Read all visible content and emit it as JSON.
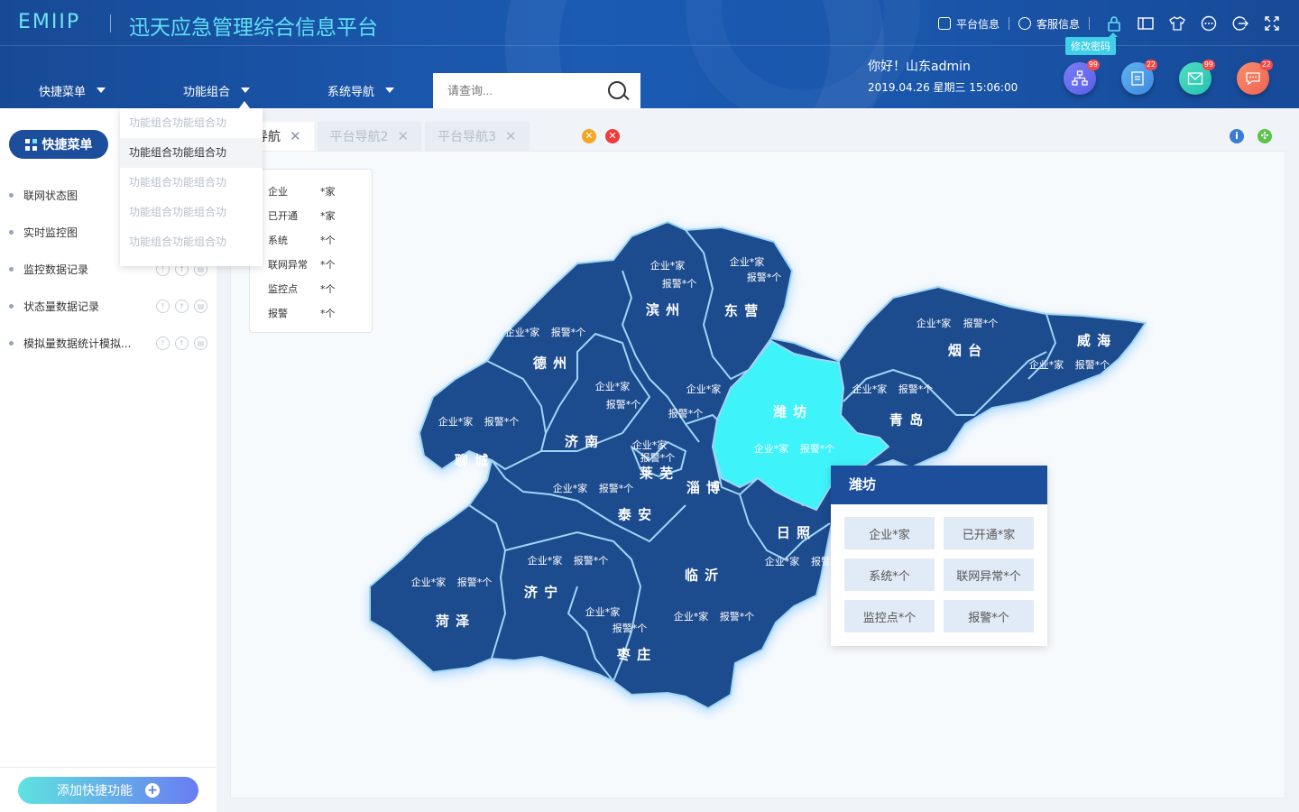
{
  "header": {
    "logo": "EMIIP",
    "title": "迅天应急管理综合信息平台",
    "links": [
      {
        "label": "平台信息",
        "icon": "monitor-icon"
      },
      {
        "label": "客服信息",
        "icon": "headset-icon"
      }
    ],
    "toolbar_icons": [
      "lock-icon",
      "book-icon",
      "shirt-icon",
      "more-icon",
      "logout-icon",
      "fullscreen-icon"
    ],
    "tooltip": "修改密码",
    "nav": [
      {
        "label": "快捷菜单"
      },
      {
        "label": "功能组合"
      },
      {
        "label": "系统导航"
      }
    ],
    "search_placeholder": "请查询...",
    "greeting": "你好！山东admin",
    "datetime": "2019.04.26  星期三  15:06:00",
    "circle_buttons": [
      {
        "icon": "org-chart-icon",
        "badge": "99",
        "color": "#6a6cf0"
      },
      {
        "icon": "document-icon",
        "badge": "22",
        "color": "#4f9de8"
      },
      {
        "icon": "mail-icon",
        "badge": "99",
        "color": "#33d1b8"
      },
      {
        "icon": "chat-icon",
        "badge": "22",
        "color": "#f3795e"
      }
    ]
  },
  "dropdown": {
    "items": [
      {
        "label": "功能组合功能组合功",
        "active": false
      },
      {
        "label": "功能组合功能组合功",
        "active": true
      },
      {
        "label": "功能组合功能组合功",
        "active": false
      },
      {
        "label": "功能组合功能组合功",
        "active": false
      },
      {
        "label": "功能组合功能组合功",
        "active": false
      }
    ]
  },
  "sidebar": {
    "button": "快捷菜单",
    "items": [
      {
        "label": "联网状态图"
      },
      {
        "label": "实时监控图"
      },
      {
        "label": "监控数据记录"
      },
      {
        "label": "状态量数据记录"
      },
      {
        "label": "模拟量数据统计模拟..."
      }
    ],
    "add_label": "添加快捷功能"
  },
  "tabs": [
    {
      "label": "台导航",
      "active": true
    },
    {
      "label": "平台导航2",
      "active": false
    },
    {
      "label": "平台导航3",
      "active": false
    }
  ],
  "stats": [
    {
      "k": "企业",
      "v": "*家"
    },
    {
      "k": "已开通",
      "v": "*家"
    },
    {
      "k": "系统",
      "v": "*个"
    },
    {
      "k": "联网异常",
      "v": "*个"
    },
    {
      "k": "监控点",
      "v": "*个"
    },
    {
      "k": "报警",
      "v": "*个"
    }
  ],
  "map": {
    "regions": [
      {
        "name": "滨 州",
        "a": "企业*家",
        "b": "报警*个",
        "highlight": false
      },
      {
        "name": "东 营",
        "a": "企业*家",
        "b": "报警*个",
        "highlight": false
      },
      {
        "name": "德 州",
        "a": "企业*家",
        "b": "报警*个",
        "highlight": false
      },
      {
        "name": "烟 台",
        "a": "企业*家",
        "b": "报警*个",
        "highlight": false
      },
      {
        "name": "威 海",
        "a": "企业*家",
        "b": "报警*个",
        "highlight": false
      },
      {
        "name": "潍 坊",
        "a": "企业*家",
        "b": "报警*个",
        "highlight": true
      },
      {
        "name": "青 岛",
        "a": "企业*家",
        "b": "报警*个",
        "highlight": false
      },
      {
        "name": "聊 城",
        "a": "企业*家",
        "b": "报警*个",
        "highlight": false
      },
      {
        "name": "济 南",
        "a": "企业*家",
        "b": "报警*个",
        "highlight": false
      },
      {
        "name": "莱 芜",
        "a": "企业*家",
        "b": "报警*个",
        "highlight": false
      },
      {
        "name": "淄 博",
        "a": "企业*家",
        "b": "报警*个",
        "highlight": false
      },
      {
        "name": "泰 安",
        "a": "企业*家",
        "b": "报警*个",
        "highlight": false
      },
      {
        "name": "日 照",
        "a": "企业*家",
        "b": "报警",
        "highlight": false
      },
      {
        "name": "济 宁",
        "a": "企业*家",
        "b": "报警*个",
        "highlight": false
      },
      {
        "name": "临 沂",
        "a": "企业*家",
        "b": "报警*个",
        "highlight": false
      },
      {
        "name": "菏 泽",
        "a": "企业*家",
        "b": "报警*个",
        "highlight": false
      },
      {
        "name": "枣 庄",
        "a": "企业*家",
        "b": "报警*个",
        "highlight": false
      }
    ]
  },
  "popup": {
    "title": "潍坊",
    "cells": [
      "企业*家",
      "已开通*家",
      "系统*个",
      "联网异常*个",
      "监控点*个",
      "报警*个"
    ]
  }
}
